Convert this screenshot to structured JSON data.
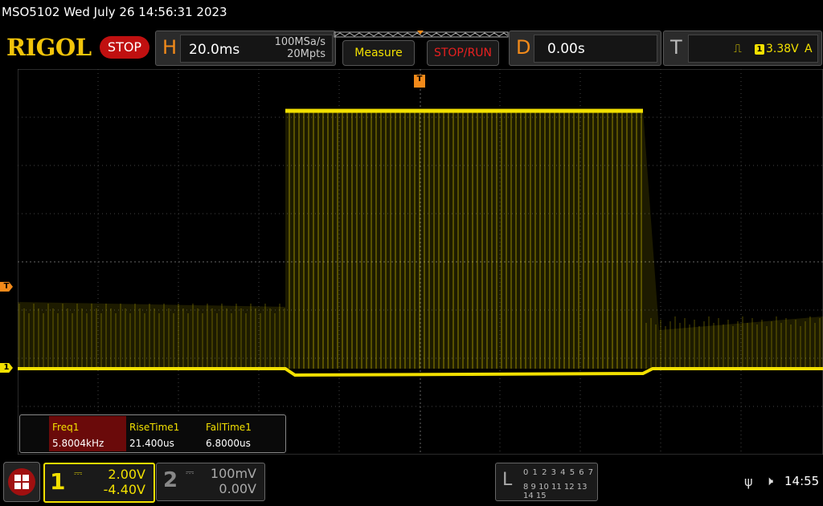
{
  "title": "MSO5102  Wed July 26 14:56:31 2023",
  "brand": "RIGOL",
  "run_state": "STOP",
  "horizontal": {
    "letter": "H",
    "timebase": "20.0ms",
    "sample_rate": "100MSa/s",
    "memory_depth": "20Mpts"
  },
  "buttons": {
    "measure": "Measure",
    "stop_run": "STOP/RUN"
  },
  "delay": {
    "letter": "D",
    "value": "0.00s"
  },
  "trigger": {
    "letter": "T",
    "source": "1",
    "level": "3.38V",
    "mode": "A",
    "edge_icon": "rising-edge-icon",
    "marker_label": "T"
  },
  "measurements": {
    "headers": [
      "Freq1",
      "RiseTime1",
      "FallTime1"
    ],
    "values": [
      "5.8004kHz",
      "21.400us",
      "6.8000us"
    ]
  },
  "channels": [
    {
      "number": "1",
      "scale": "2.00V",
      "offset": "-4.40V",
      "color": "#f2e000",
      "active": true
    },
    {
      "number": "2",
      "scale": "100mV",
      "offset": "0.00V",
      "color": "#888888",
      "active": false
    }
  ],
  "logic": {
    "letter": "L",
    "row1": "0 1 2 3  4 5 6 7",
    "row2": "8 9 10 11 12 13 14 15"
  },
  "status": {
    "time": "14:55",
    "usb_icon": "usb-icon",
    "speaker_icon": "speaker-muted-icon"
  },
  "colors": {
    "accent": "#f2e000",
    "orange": "#f28a1a",
    "stop_red": "#c01010"
  }
}
